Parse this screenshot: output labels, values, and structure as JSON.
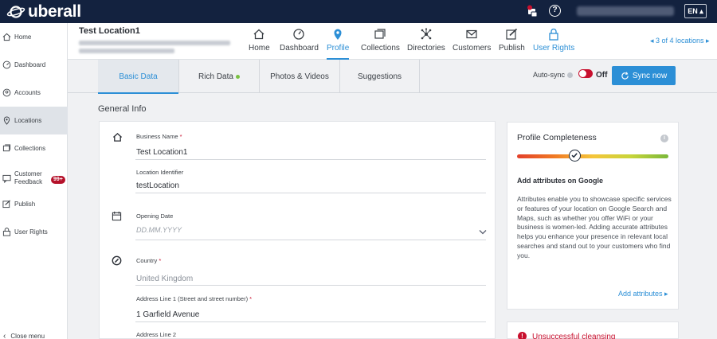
{
  "brand": {
    "name": "uberall"
  },
  "topbar": {
    "lang": "EN ▴",
    "help": "?"
  },
  "sidebar": {
    "items": [
      {
        "label": "Home",
        "icon": "home-icon"
      },
      {
        "label": "Dashboard",
        "icon": "dashboard-icon"
      },
      {
        "label": "Accounts",
        "icon": "accounts-icon"
      },
      {
        "label": "Locations",
        "icon": "location-pin-icon",
        "active": true
      },
      {
        "label": "Collections",
        "icon": "collections-icon"
      },
      {
        "label": "Customer Feedback",
        "icon": "feedback-icon"
      },
      {
        "label": "Publish",
        "icon": "publish-icon"
      },
      {
        "label": "User Rights",
        "icon": "user-rights-icon"
      }
    ],
    "feedback_badge": "99+",
    "close_menu": "Close menu"
  },
  "header": {
    "location_title": "Test Location1",
    "nav": [
      {
        "label": "Home",
        "icon": "home-icon"
      },
      {
        "label": "Dashboard",
        "icon": "dashboard-icon"
      },
      {
        "label": "Profile",
        "icon": "location-pin-icon",
        "active": true
      },
      {
        "label": "Collections",
        "icon": "collections-icon"
      },
      {
        "label": "Directories",
        "icon": "directories-icon"
      },
      {
        "label": "Customers",
        "icon": "mail-icon"
      },
      {
        "label": "Publish",
        "icon": "publish-icon"
      },
      {
        "label": "User Rights",
        "icon": "lock-icon"
      }
    ],
    "location_count": "◂ 3 of 4 locations ▸"
  },
  "tabs": {
    "items": [
      {
        "label": "Basic Data",
        "active": true
      },
      {
        "label": "Rich Data",
        "status_dot": "green"
      },
      {
        "label": "Photos & Videos"
      },
      {
        "label": "Suggestions"
      }
    ],
    "autosync_label": "Auto-sync",
    "toggle_state": "Off",
    "sync_button": "Sync now"
  },
  "general_info": {
    "title": "General Info",
    "fields": {
      "business_name_label": "Business Name",
      "business_name_value": "Test Location1",
      "location_identifier_label": "Location Identifier",
      "location_identifier_value": "testLocation",
      "opening_date_label": "Opening Date",
      "opening_date_placeholder": "DD.MM.YYYY",
      "country_label": "Country",
      "country_value": "United Kingdom",
      "address1_label": "Address Line 1 (Street and street number)",
      "address1_value": "1 Garfield Avenue",
      "address2_label": "Address Line 2"
    },
    "required_marker": "*"
  },
  "profile_completeness": {
    "title": "Profile Completeness",
    "info": "i",
    "progress": 0.38,
    "subtitle": "Add attributes on Google",
    "text": "Attributes enable you to showcase specific services or features of your location on Google Search and Maps, such as whether you offer WiFi or your business is women-led. Adding accurate attributes helps you enhance your presence in relevant local searches and stand out to your customers who find you.",
    "link": "Add attributes ▸"
  },
  "cleansing": {
    "icon_text": "!",
    "text": "Unsuccessful cleansing"
  },
  "colors": {
    "topbar": "#13223f",
    "accent": "#2c8fd6",
    "danger": "#c8102e",
    "success": "#7ac143"
  }
}
